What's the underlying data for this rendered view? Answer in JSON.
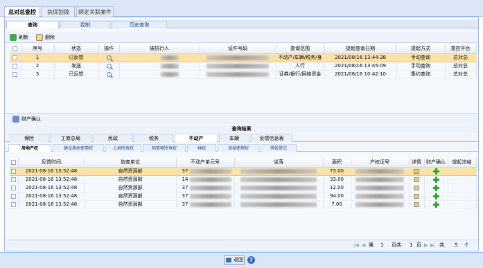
{
  "top_tabs": [
    {
      "label": "总对总查控",
      "active": true
    },
    {
      "label": "执保划拨",
      "active": false
    },
    {
      "label": "绑定关联案件",
      "active": false
    }
  ],
  "sub_tabs": [
    {
      "label": "查询",
      "active": true
    },
    {
      "label": "控制",
      "active": false
    },
    {
      "label": "历史查询",
      "active": false
    }
  ],
  "toolbar": {
    "refresh_label": "刷新",
    "delete_label": "删除"
  },
  "query_table": {
    "headers": [
      "序号",
      "状态",
      "操作",
      "被执行人",
      "证件号码",
      "查询范围",
      "提起查询日期",
      "提起方式",
      "查控平台"
    ],
    "header_partial_3": "被执行人",
    "rows": [
      {
        "no": "1",
        "status": "已反馈",
        "scope": "不动产/车辆/税务/身",
        "date": "2021/08/16 13:44:38",
        "method": "手动查询",
        "platform": "总对总",
        "selected": true
      },
      {
        "no": "2",
        "status": "发送",
        "scope": "人行",
        "date": "2021/08/16 13:45:09",
        "method": "手动查询",
        "platform": "总对总",
        "selected": false
      },
      {
        "no": "3",
        "status": "已反馈",
        "scope": "证券/银行/网络资金",
        "date": "2021/08/16 10:42:10",
        "method": "集约查询",
        "platform": "总对总",
        "selected": false
      }
    ]
  },
  "lower_toolbar": {
    "property_confirm_label": "财产确认"
  },
  "results_title": "查询结果",
  "category_tabs": [
    {
      "label": "保险",
      "active": false
    },
    {
      "label": "工商总局",
      "active": false
    },
    {
      "label": "民政",
      "active": false
    },
    {
      "label": "税务",
      "active": false
    },
    {
      "label": "不动产",
      "active": true
    },
    {
      "label": "车辆",
      "active": false
    },
    {
      "label": "反馈信息表",
      "active": false
    }
  ],
  "property_tabs": [
    {
      "label": "房地产权",
      "active": true
    },
    {
      "label": "建设用地使用权",
      "active": false
    },
    {
      "label": "土地所有权",
      "active": false
    },
    {
      "label": "构筑物所有权",
      "active": false
    },
    {
      "label": "林权",
      "active": false
    },
    {
      "label": "海域使用权",
      "active": false
    },
    {
      "label": "预告登记",
      "active": false
    }
  ],
  "result_table": {
    "headers": [
      "反馈时间",
      "协查单位",
      "不动产单元号",
      "坐落",
      "面积",
      "产权证号",
      "详情",
      "财产确认",
      "提起冻结"
    ],
    "rows": [
      {
        "time": "2021-08-16 13:52:48",
        "unit": "自然资源部",
        "unit_no_prefix": "37",
        "area": "73.00",
        "selected": true
      },
      {
        "time": "2021-08-16 13:52:48",
        "unit": "自然资源部",
        "unit_no_prefix": "14",
        "area": "33.00",
        "selected": false
      },
      {
        "time": "2021-08-16 13:52:48",
        "unit": "自然资源部",
        "unit_no_prefix": "37",
        "area": "12.00",
        "selected": false
      },
      {
        "time": "2021-08-16 13:52:48",
        "unit": "自然资源部",
        "unit_no_prefix": "37",
        "area": "94.00",
        "selected": false
      },
      {
        "time": "2021-08-16 13:52:48",
        "unit": "自然资源部",
        "unit_no_prefix": "37",
        "area": "7.00",
        "selected": false
      }
    ]
  },
  "pager": {
    "page_prefix": "第",
    "page": "1",
    "page_suffix": "页共",
    "total_pages": "1",
    "pages_unit": "页",
    "total_prefix": "共",
    "total": "5",
    "total_unit": "个"
  },
  "bottom": {
    "back_label": "返回",
    "help_glyph": "?"
  },
  "colors": {
    "accent": "#99bbe8",
    "selected_row": "#fbe3a8",
    "plus": "#2fa12c"
  }
}
